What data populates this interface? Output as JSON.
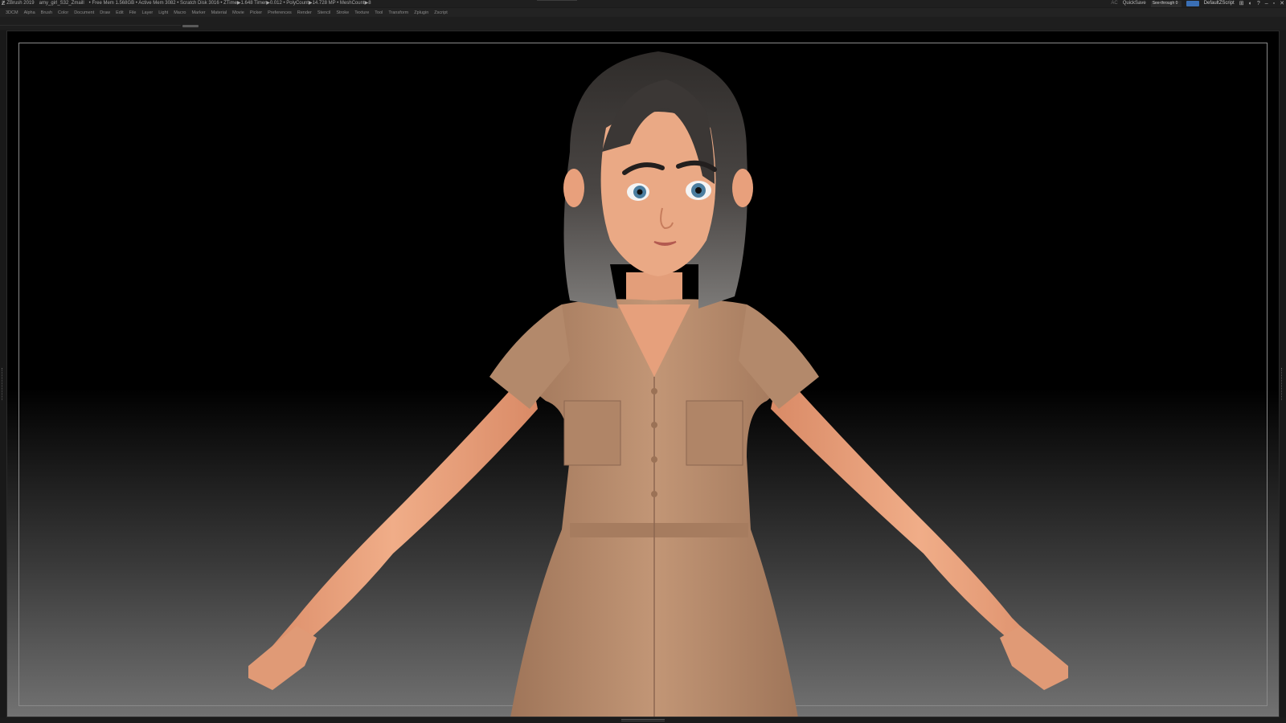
{
  "titlebar": {
    "app": "ZBrush 2019",
    "file": "amy_girl_S32_Zmaill",
    "stats": "• Free Mem 1.568GB • Active Mem 3082 • Scratch Disk 3016 • ZTime▶1.648 Timer▶0.012 • PolyCount▶14.728 MP • MeshCount▶8",
    "ac": "AC",
    "quicksave": "QuickSave",
    "seethrough_label": "See-through",
    "seethrough_value": "0",
    "seethrough_fraction": 0,
    "script": "DefaultZScript"
  },
  "menus": [
    "3DCM",
    "Alpha",
    "Brush",
    "Color",
    "Document",
    "Draw",
    "Edit",
    "File",
    "Layer",
    "Light",
    "Macro",
    "Marker",
    "Material",
    "Movie",
    "Picker",
    "Preferences",
    "Render",
    "Stencil",
    "Stroke",
    "Texture",
    "Tool",
    "Transform",
    "Zplugin",
    "Zscript"
  ],
  "colors": {
    "accent_blue": "#3a6fb5",
    "slider_orange": "#d18a2b",
    "skin": "#e8a37e",
    "dress": "#b88d6e",
    "hair": "#3a3634"
  },
  "icons": [
    "zbrush-logo-icon",
    "menus-toggle-icon",
    "interface-icon",
    "palette-icon",
    "help-icon",
    "minimize-icon",
    "restore-icon",
    "close-icon"
  ]
}
